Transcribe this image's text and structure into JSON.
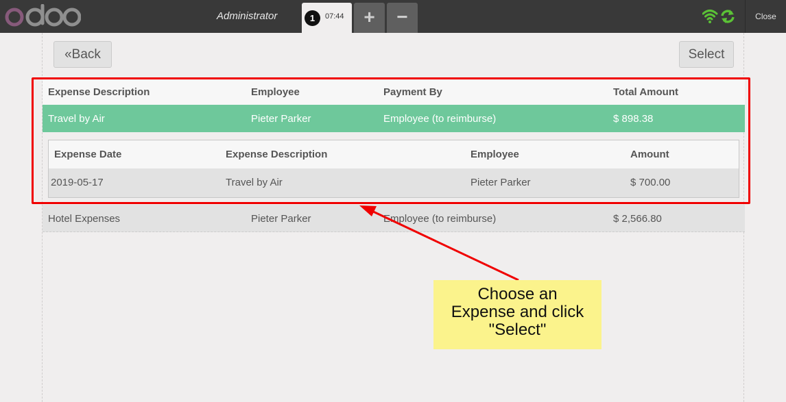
{
  "topbar": {
    "cashier": "Administrator",
    "order": {
      "number": "1",
      "time": "07:44"
    },
    "add_label": "+",
    "remove_label": "−",
    "close_label": "Close"
  },
  "actions": {
    "back_label": "Back",
    "select_label": "Select"
  },
  "expense_table": {
    "columns": [
      "Expense Description",
      "Employee",
      "Payment By",
      "Total Amount"
    ],
    "rows": [
      {
        "description": "Travel by Air",
        "employee": "Pieter Parker",
        "payment_by": "Employee (to reimburse)",
        "total": "$ 898.38"
      },
      {
        "description": "Hotel Expenses",
        "employee": "Pieter Parker",
        "payment_by": "Employee (to reimburse)",
        "total": "$ 2,566.80"
      }
    ]
  },
  "detail_table": {
    "columns": [
      "Expense Date",
      "Expense Description",
      "Employee",
      "Amount"
    ],
    "rows": [
      {
        "date": "2019-05-17",
        "description": "Travel by Air",
        "employee": "Pieter Parker",
        "amount": "$ 700.00"
      }
    ]
  },
  "annotation": {
    "text_lines": [
      "Choose an",
      "Expense and click",
      "\"Select\""
    ],
    "highlight_color": "#f00000",
    "callout_color": "#fbf38c"
  },
  "colors": {
    "selected_row": "#6ec89b",
    "topbar": "#393939",
    "status_icons": "#5bc236",
    "logo": "#875a7b"
  },
  "icons": {
    "logo": "odoo-logo-icon",
    "wifi": "wifi-icon",
    "sync": "sync-icon",
    "back": "double-chevron-left-icon"
  }
}
